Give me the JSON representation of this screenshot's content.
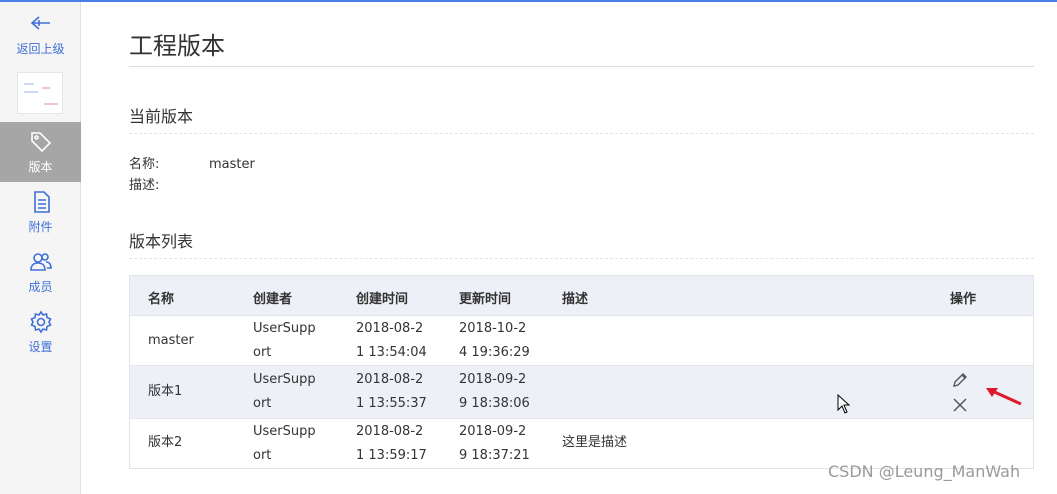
{
  "sidebar": {
    "back_label": "返回上级",
    "items": [
      {
        "label": "版本",
        "icon": "tag-icon",
        "active": true
      },
      {
        "label": "附件",
        "icon": "document-icon",
        "active": false
      },
      {
        "label": "成员",
        "icon": "users-icon",
        "active": false
      },
      {
        "label": "设置",
        "icon": "gear-icon",
        "active": false
      }
    ]
  },
  "page": {
    "title": "工程版本"
  },
  "current_version": {
    "section_title": "当前版本",
    "name_label": "名称:",
    "name_value": "master",
    "desc_label": "描述:",
    "desc_value": ""
  },
  "version_list": {
    "section_title": "版本列表",
    "columns": [
      "名称",
      "创建者",
      "创建时间",
      "更新时间",
      "描述",
      "操作"
    ],
    "rows": [
      {
        "name": "master",
        "creator": [
          "UserSupp",
          "ort"
        ],
        "created": [
          "2018-08-2",
          "1 13:54:04"
        ],
        "updated": [
          "2018-10-2",
          "4 19:36:29"
        ],
        "description": ""
      },
      {
        "name": "版本1",
        "creator": [
          "UserSupp",
          "ort"
        ],
        "created": [
          "2018-08-2",
          "1 13:55:37"
        ],
        "updated": [
          "2018-09-2",
          "9 18:38:06"
        ],
        "description": ""
      },
      {
        "name": "版本2",
        "creator": [
          "UserSupp",
          "ort"
        ],
        "created": [
          "2018-08-2",
          "1 13:59:17"
        ],
        "updated": [
          "2018-09-2",
          "9 18:37:21"
        ],
        "description": "这里是描述"
      }
    ]
  },
  "watermark": "CSDN @Leung_ManWah",
  "colors": {
    "accent": "#3f6fd8",
    "arrow": "#e0192a",
    "header_bg": "#eef0f7"
  }
}
